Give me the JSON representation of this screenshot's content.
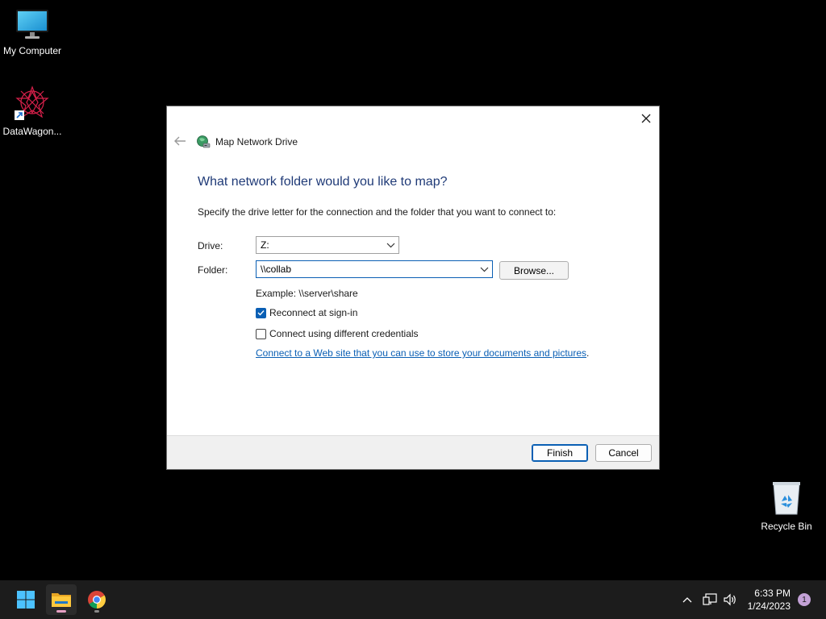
{
  "desktop": {
    "icons": [
      {
        "label": "My Computer"
      },
      {
        "label": "DataWagon..."
      },
      {
        "label": "Recycle Bin"
      }
    ]
  },
  "dialog": {
    "title": "Map Network Drive",
    "heading": "What network folder would you like to map?",
    "instructions": "Specify the drive letter for the connection and the folder that you want to connect to:",
    "drive": {
      "label": "Drive:",
      "value": "Z:"
    },
    "folder": {
      "label": "Folder:",
      "value": "\\\\collab"
    },
    "browse_label": "Browse...",
    "example": "Example: \\\\server\\share",
    "reconnect": {
      "label": "Reconnect at sign-in",
      "checked": true
    },
    "credentials": {
      "label": "Connect using different credentials",
      "checked": false
    },
    "link_text": "Connect to a Web site that you can use to store your documents and pictures",
    "link_suffix": ".",
    "finish_label": "Finish",
    "cancel_label": "Cancel"
  },
  "taskbar": {
    "time": "6:33 PM",
    "date": "1/24/2023",
    "notification_count": "1"
  },
  "colors": {
    "accent": "#0a5fb4",
    "heading": "#1f3a77",
    "taskbar": "#1c1c1c"
  }
}
